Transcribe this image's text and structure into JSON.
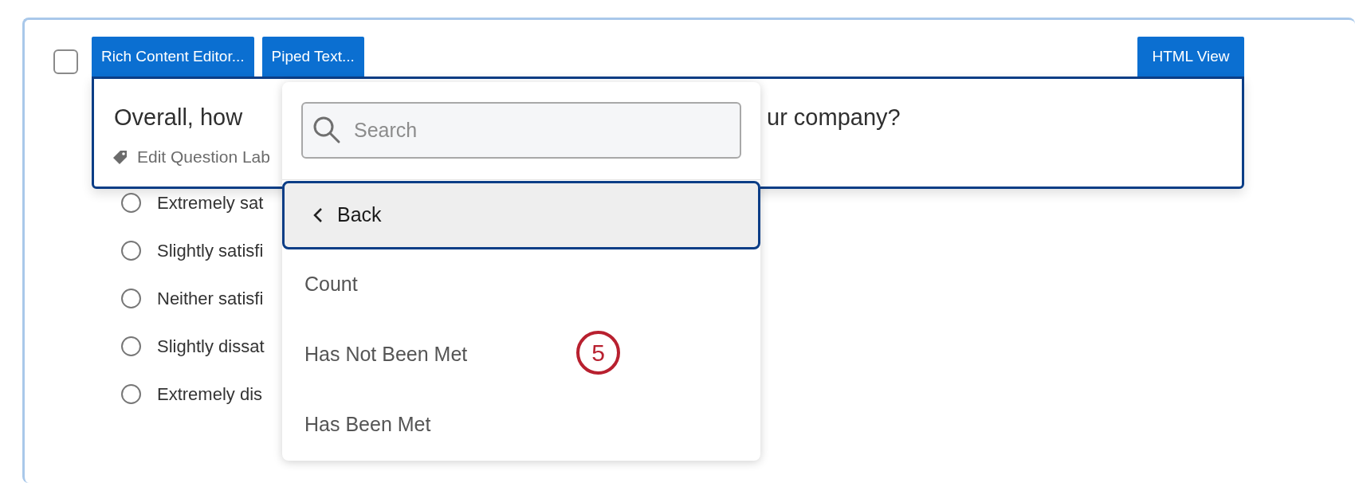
{
  "question_checkbox": {
    "checked": false
  },
  "toolbar": {
    "left_buttons": [
      "Rich Content Editor...",
      "Piped Text..."
    ],
    "right_button": "HTML View"
  },
  "question": {
    "text_before": "Overall, how",
    "text_after": "ur company?",
    "label_link": "Edit Question Lab"
  },
  "options": [
    {
      "label": "Extremely sat",
      "selected": false
    },
    {
      "label": "Slightly satisfi",
      "selected": false
    },
    {
      "label": "Neither satisfi",
      "selected": false
    },
    {
      "label": "Slightly dissat",
      "selected": false
    },
    {
      "label": "Extremely dis",
      "selected": false
    }
  ],
  "dropdown": {
    "search": {
      "placeholder": "Search"
    },
    "back": "Back",
    "items": [
      {
        "label": "Count"
      },
      {
        "label": "Has Not Been Met"
      },
      {
        "label": "Has Been Met"
      }
    ]
  },
  "callout": "5"
}
